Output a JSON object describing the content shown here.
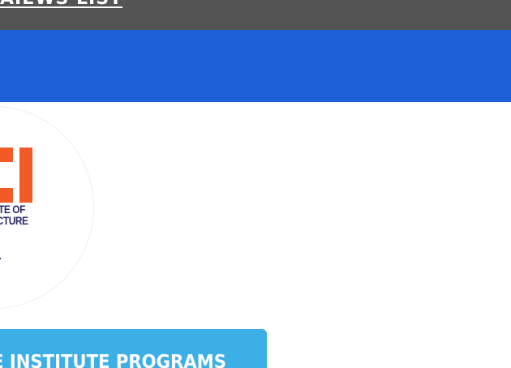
{
  "topbar": {
    "link_text": "AIEWS LIST",
    "background": "#545454"
  },
  "banner": {
    "background": "#1c60d5"
  },
  "logo": {
    "mark_letters": "CI",
    "text_line_1": "TE OF",
    "text_line_2": "TRUCTURE",
    "accent_color": "#f45a25",
    "text_color": "#2a2a6a"
  },
  "programs": {
    "label": "E INSTITUTE PROGRAMS",
    "background": "#3cb0e6"
  }
}
